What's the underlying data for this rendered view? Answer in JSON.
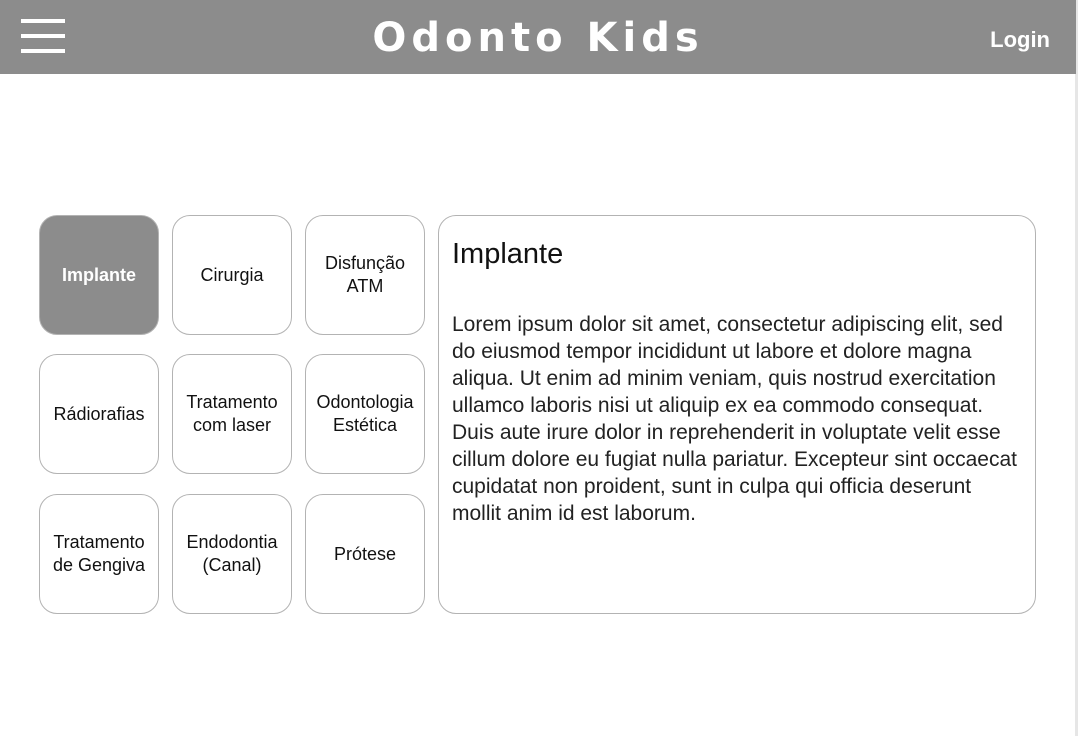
{
  "header": {
    "title": "Odonto Kids",
    "login_label": "Login",
    "menu_icon": "hamburger-menu-icon",
    "background_color": "#8c8c8c"
  },
  "services": {
    "active": "Implante",
    "items": [
      {
        "label": "Implante"
      },
      {
        "label": "Cirurgia"
      },
      {
        "label": "Disfunção ATM"
      },
      {
        "label": "Rádiorafias"
      },
      {
        "label": "Tratamento com laser"
      },
      {
        "label": "Odontologia Estética"
      },
      {
        "label": "Tratamento de Gengiva"
      },
      {
        "label": "Endodontia (Canal)"
      },
      {
        "label": "Prótese"
      }
    ]
  },
  "detail": {
    "title": "Implante",
    "body": "Lorem ipsum dolor sit amet, consectetur adipiscing elit, sed do eiusmod tempor incididunt ut labore et dolore magna aliqua. Ut enim ad minim veniam, quis nostrud exercitation ullamco laboris nisi ut aliquip ex ea commodo consequat. Duis aute irure dolor in reprehenderit in voluptate velit esse cillum dolore eu fugiat nulla pariatur. Excepteur sint occaecat cupidatat non proident, sunt in culpa qui officia deserunt mollit anim id est laborum."
  }
}
